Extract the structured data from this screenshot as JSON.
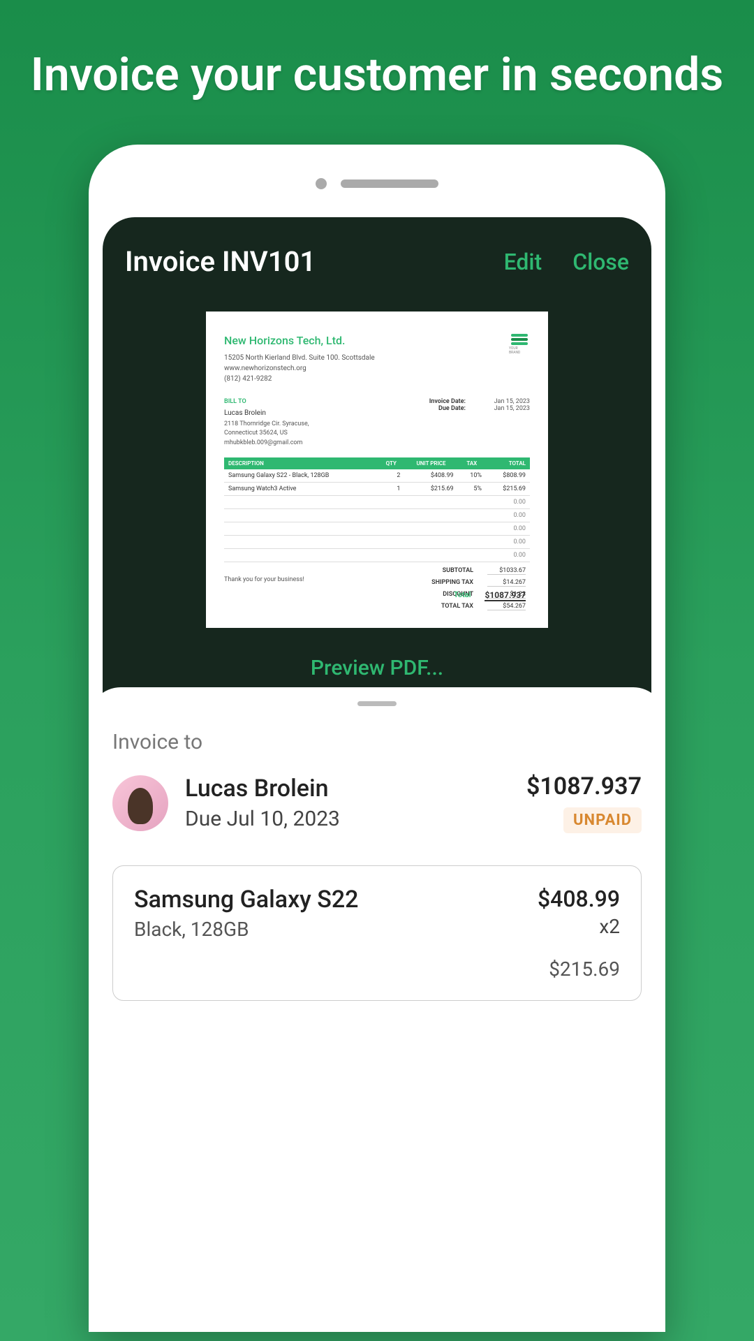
{
  "hero": "Invoice your customer in seconds",
  "header": {
    "title": "Invoice INV101",
    "edit": "Edit",
    "close": "Close"
  },
  "invoice": {
    "company_name": "New Horizons Tech, Ltd.",
    "address": "15205 North Kierland Blvd. Suite 100. Scottsdale",
    "website": "www.newhorizonstech.org",
    "phone": "(812) 421-9282",
    "logo_text": "YOUR BRAND",
    "billto_label": "BILL TO",
    "billto_name": "Lucas Brolein",
    "billto_addr1": "2118 Thornridge Cir. Syracuse,",
    "billto_addr2": "Connecticut 35624, US",
    "billto_email": "mhubkbleb.009@gmail.com",
    "invoice_date_label": "Invoice Date:",
    "invoice_date": "Jan 15, 2023",
    "due_date_label": "Due Date:",
    "due_date": "Jan 15, 2023",
    "cols": {
      "desc": "DESCRIPTION",
      "qty": "QTY",
      "unit": "UNIT PRICE",
      "tax": "TAX",
      "total": "TOTAL"
    },
    "rows": [
      {
        "desc": "Samsung Galaxy S22 - Black, 128GB",
        "qty": "2",
        "unit": "$408.99",
        "tax": "10%",
        "total": "$808.99"
      },
      {
        "desc": "Samsung Watch3 Active",
        "qty": "1",
        "unit": "$215.69",
        "tax": "5%",
        "total": "$215.69"
      }
    ],
    "empty_val": "0.00",
    "subtotal_label": "SUBTOTAL",
    "subtotal": "$1033.67",
    "shipping_label": "SHIPPING TAX",
    "shipping": "$14.267",
    "discount_label": "DISCOUNT",
    "discount": "$1.23",
    "totaltax_label": "TOTAL TAX",
    "totaltax": "$54.267",
    "grand_label": "Total",
    "grand_total": "$1087.937",
    "thanks": "Thank you for your business!"
  },
  "preview_link": "Preview PDF...",
  "sheet": {
    "invoice_to": "Invoice to",
    "customer_name": "Lucas Brolein",
    "due": "Due Jul 10, 2023",
    "amount": "$1087.937",
    "status": "UNPAID",
    "item1": {
      "name": "Samsung Galaxy S22",
      "variant": "Black, 128GB",
      "price": "$408.99",
      "qty": "x2",
      "subtotal": "$215.69"
    }
  }
}
